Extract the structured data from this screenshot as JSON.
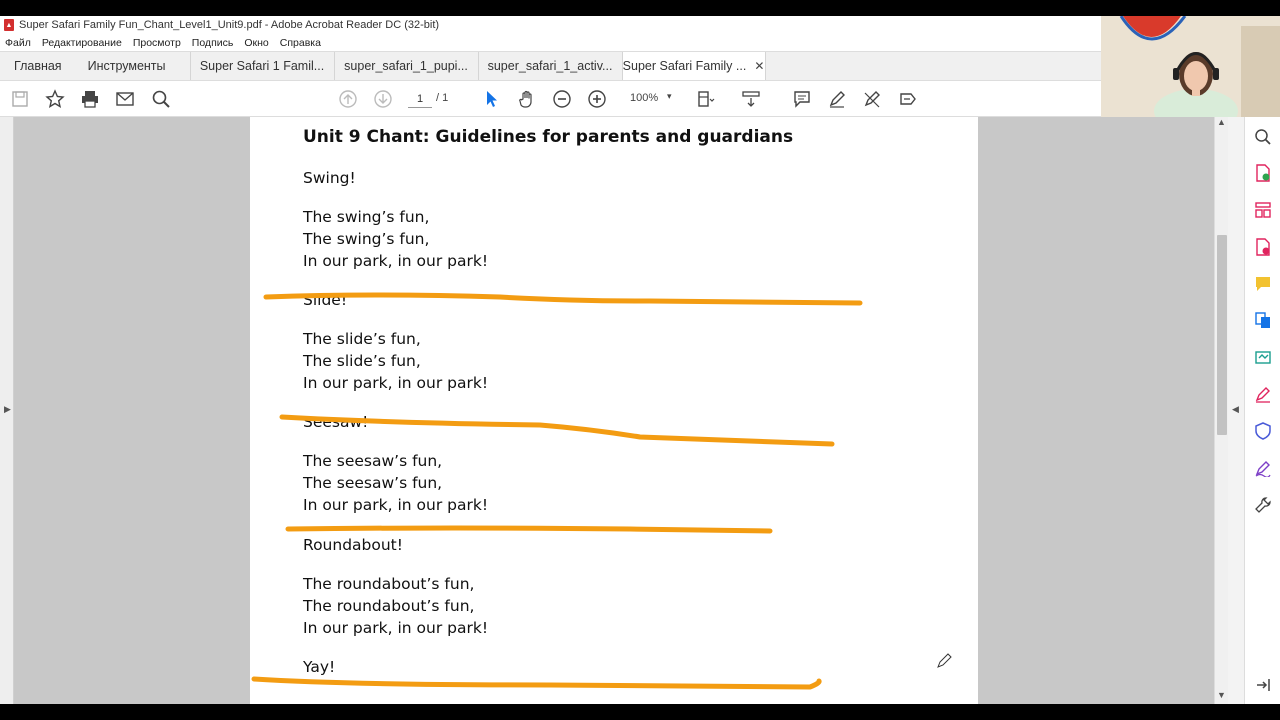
{
  "window": {
    "title": "Super Safari Family Fun_Chant_Level1_Unit9.pdf - Adobe Acrobat Reader DC (32-bit)"
  },
  "menu": [
    "Файл",
    "Редактирование",
    "Просмотр",
    "Подпись",
    "Окно",
    "Справка"
  ],
  "tabs": {
    "home": "Главная",
    "tools": "Инструменты",
    "docs": [
      "Super Safari 1 Famil...",
      "super_safari_1_pupi...",
      "super_safari_1_activ..."
    ],
    "active": "Super Safari Family ...",
    "close_glyph": "✕"
  },
  "toolbar": {
    "page_current": "1",
    "page_total": "/ 1",
    "zoom": "100%",
    "zoom_arrow": "▾",
    "icons": [
      "save-icon",
      "bookmark-star-icon",
      "print-icon",
      "email-icon",
      "search-zoom-icon",
      "page-up-icon",
      "page-down-icon",
      "select-cursor-icon",
      "hand-icon",
      "zoom-out-icon",
      "zoom-in-icon",
      "page-layout-icon",
      "scroll-mode-icon",
      "comment-icon",
      "highlight-pen-icon",
      "draw-icon",
      "fill-sign-icon"
    ]
  },
  "document": {
    "title": "Unit 9 Chant: Guidelines for parents and guardians",
    "lines": [
      "Swing!",
      "The swing’s fun,",
      "The swing’s fun,",
      "In our park, in our park!",
      "Slide!",
      "The slide’s fun,",
      "The slide’s fun,",
      "In our park, in our park!",
      "Seesaw!",
      "The seesaw’s fun,",
      "The seesaw’s fun,",
      "In our park, in our park!",
      "Roundabout!",
      "The roundabout’s fun,",
      "The roundabout’s fun,",
      "In our park, in our park!",
      "Yay!"
    ]
  },
  "colors": {
    "ink": "#f39c12",
    "accent_blue": "#1473e6",
    "panel_green": "#2da44e",
    "panel_pink": "#e0245e"
  },
  "right_panel_icons": [
    "zoom-search-icon",
    "create-pdf-icon",
    "organize-pages-icon",
    "export-pdf-icon",
    "comment-panel-icon",
    "combine-files-icon",
    "send-track-icon",
    "fill-sign-panel-icon",
    "protect-icon",
    "sign-icon",
    "more-tools-icon",
    "collapse-panel-icon"
  ]
}
